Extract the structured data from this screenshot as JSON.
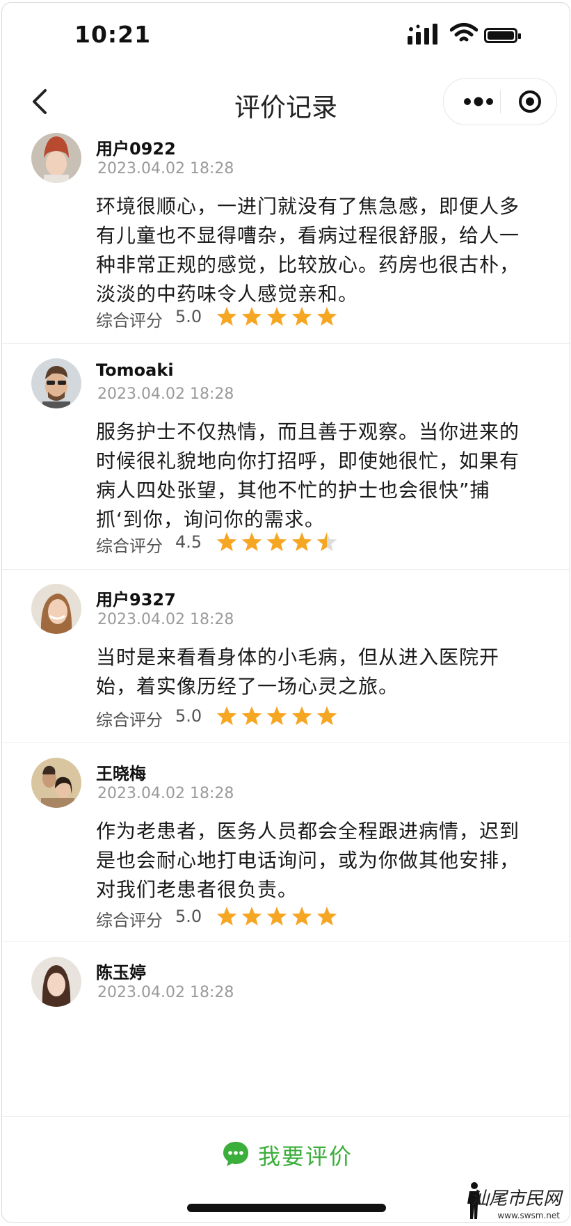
{
  "status_bar": {
    "time": "10:21"
  },
  "nav": {
    "title": "评价记录"
  },
  "rating_label": "综合评分",
  "reviews": [
    {
      "username": "用户0922",
      "date": "2023.04.02 18:28",
      "lines": [
        "环境很顺心，一进门就没有了焦急感，即便人多",
        "有儿童也不显得嘈杂，看病过程很舒服，给人一",
        "种非常正规的感觉，比较放心。药房也很古朴，",
        "淡淡的中药味令人感觉亲和。"
      ],
      "score": "5.0",
      "stars": 5.0
    },
    {
      "username": "Tomoaki",
      "date": "2023.04.02 18:28",
      "lines": [
        "服务护士不仅热情，而且善于观察。当你进来的",
        "时候很礼貌地向你打招呼，即使她很忙，如果有",
        "病人四处张望，其他不忙的护士也会很快”捕",
        "抓‘到你，询问你的需求。"
      ],
      "score": "4.5",
      "stars": 4.5
    },
    {
      "username": "用户9327",
      "date": "2023.04.02 18:28",
      "lines": [
        "当时是来看看身体的小毛病，但从进入医院开",
        "始，着实像历经了一场心灵之旅。"
      ],
      "score": "5.0",
      "stars": 5.0
    },
    {
      "username": "王晓梅",
      "date": "2023.04.02 18:28",
      "lines": [
        "作为老患者，医务人员都会全程跟进病情，迟到",
        "是也会耐心地打电话询问，或为你做其他安排，",
        "对我们老患者很负责。"
      ],
      "score": "5.0",
      "stars": 5.0
    },
    {
      "username": "陈玉婷",
      "date": "2023.04.02 18:28"
    }
  ],
  "bottom": {
    "cta_label": "我要评价"
  },
  "watermark": {
    "text": "汕尾市民网",
    "url": "www.swsm.net"
  },
  "colors": {
    "star": "#f5a623",
    "star_empty": "#dcdcdc",
    "cta": "#3bae3b",
    "date": "#9a9a9a"
  }
}
